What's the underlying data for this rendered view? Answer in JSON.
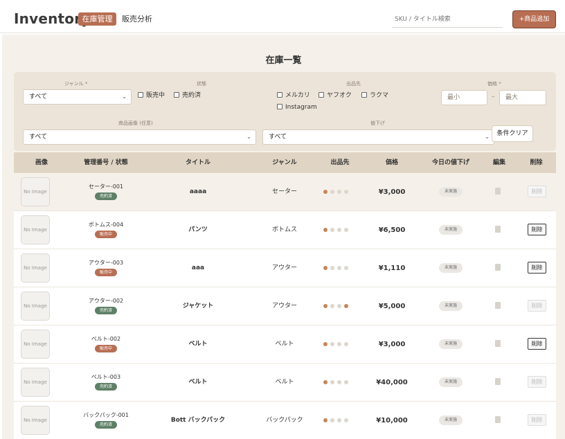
{
  "header": {
    "brand": "Inventory",
    "nav": [
      "在庫管理",
      "販売分析"
    ],
    "search_placeholder": "SKU / タイトル検索",
    "add_button": "+商品追加"
  },
  "page_title": "在庫一覧",
  "filters": {
    "genre_label": "ジャンル *",
    "genre_value": "すべて",
    "status_label": "状態",
    "status_options": [
      "販売中",
      "売約済"
    ],
    "channel_label": "出品先",
    "channel_options": [
      "メルカリ",
      "ヤフオク",
      "ラクマ",
      "Instagram"
    ],
    "price_label": "価格 *",
    "price_min_placeholder": "最小",
    "price_sep": "–",
    "price_max_placeholder": "最大",
    "image_label": "商品画像 (任意)",
    "image_value": "すべて",
    "markdown_label": "値下げ",
    "markdown_value": "すべて",
    "clear_button": "条件クリア"
  },
  "table": {
    "headers": [
      "画像",
      "管理番号 / 状態",
      "タイトル",
      "ジャンル",
      "出品先",
      "価格",
      "今日の値下げ",
      "編集",
      "削除"
    ],
    "no_image": "No Image",
    "pending_label": "未実施",
    "delete_label": "削除",
    "rows": [
      {
        "sku": "セーター-001",
        "status": "売約済",
        "status_type": "sold",
        "title": "aaaa",
        "genre": "セーター",
        "dots": [
          1,
          0,
          0,
          0
        ],
        "price": "¥3,000",
        "deletable": false
      },
      {
        "sku": "ボトムス-004",
        "status": "販売中",
        "status_type": "selling",
        "title": "パンツ",
        "genre": "ボトムス",
        "dots": [
          1,
          0,
          0,
          0
        ],
        "price": "¥6,500",
        "deletable": true
      },
      {
        "sku": "アウター-003",
        "status": "販売中",
        "status_type": "selling",
        "title": "aaa",
        "genre": "アウター",
        "dots": [
          1,
          0,
          0,
          0
        ],
        "price": "¥1,110",
        "deletable": true
      },
      {
        "sku": "アウター-002",
        "status": "売約済",
        "status_type": "sold",
        "title": "ジャケット",
        "genre": "アウター",
        "dots": [
          1,
          0,
          0,
          1
        ],
        "price": "¥5,000",
        "deletable": false
      },
      {
        "sku": "ベルト-002",
        "status": "販売中",
        "status_type": "selling",
        "title": "ベルト",
        "genre": "ベルト",
        "dots": [
          1,
          0,
          0,
          0
        ],
        "price": "¥3,000",
        "deletable": true
      },
      {
        "sku": "ベルト-003",
        "status": "売約済",
        "status_type": "sold",
        "title": "ベルト",
        "genre": "ベルト",
        "dots": [
          1,
          0,
          0,
          0
        ],
        "price": "¥40,000",
        "deletable": false
      },
      {
        "sku": "バックパック-001",
        "status": "売約済",
        "status_type": "sold",
        "title": "Bott バックパック",
        "genre": "バックパック",
        "dots": [
          1,
          0,
          0,
          0
        ],
        "price": "¥10,000",
        "deletable": false
      }
    ]
  },
  "colors": {
    "accent": "#b86e52",
    "sold": "#5d8066",
    "background": "#f5f1ea"
  }
}
